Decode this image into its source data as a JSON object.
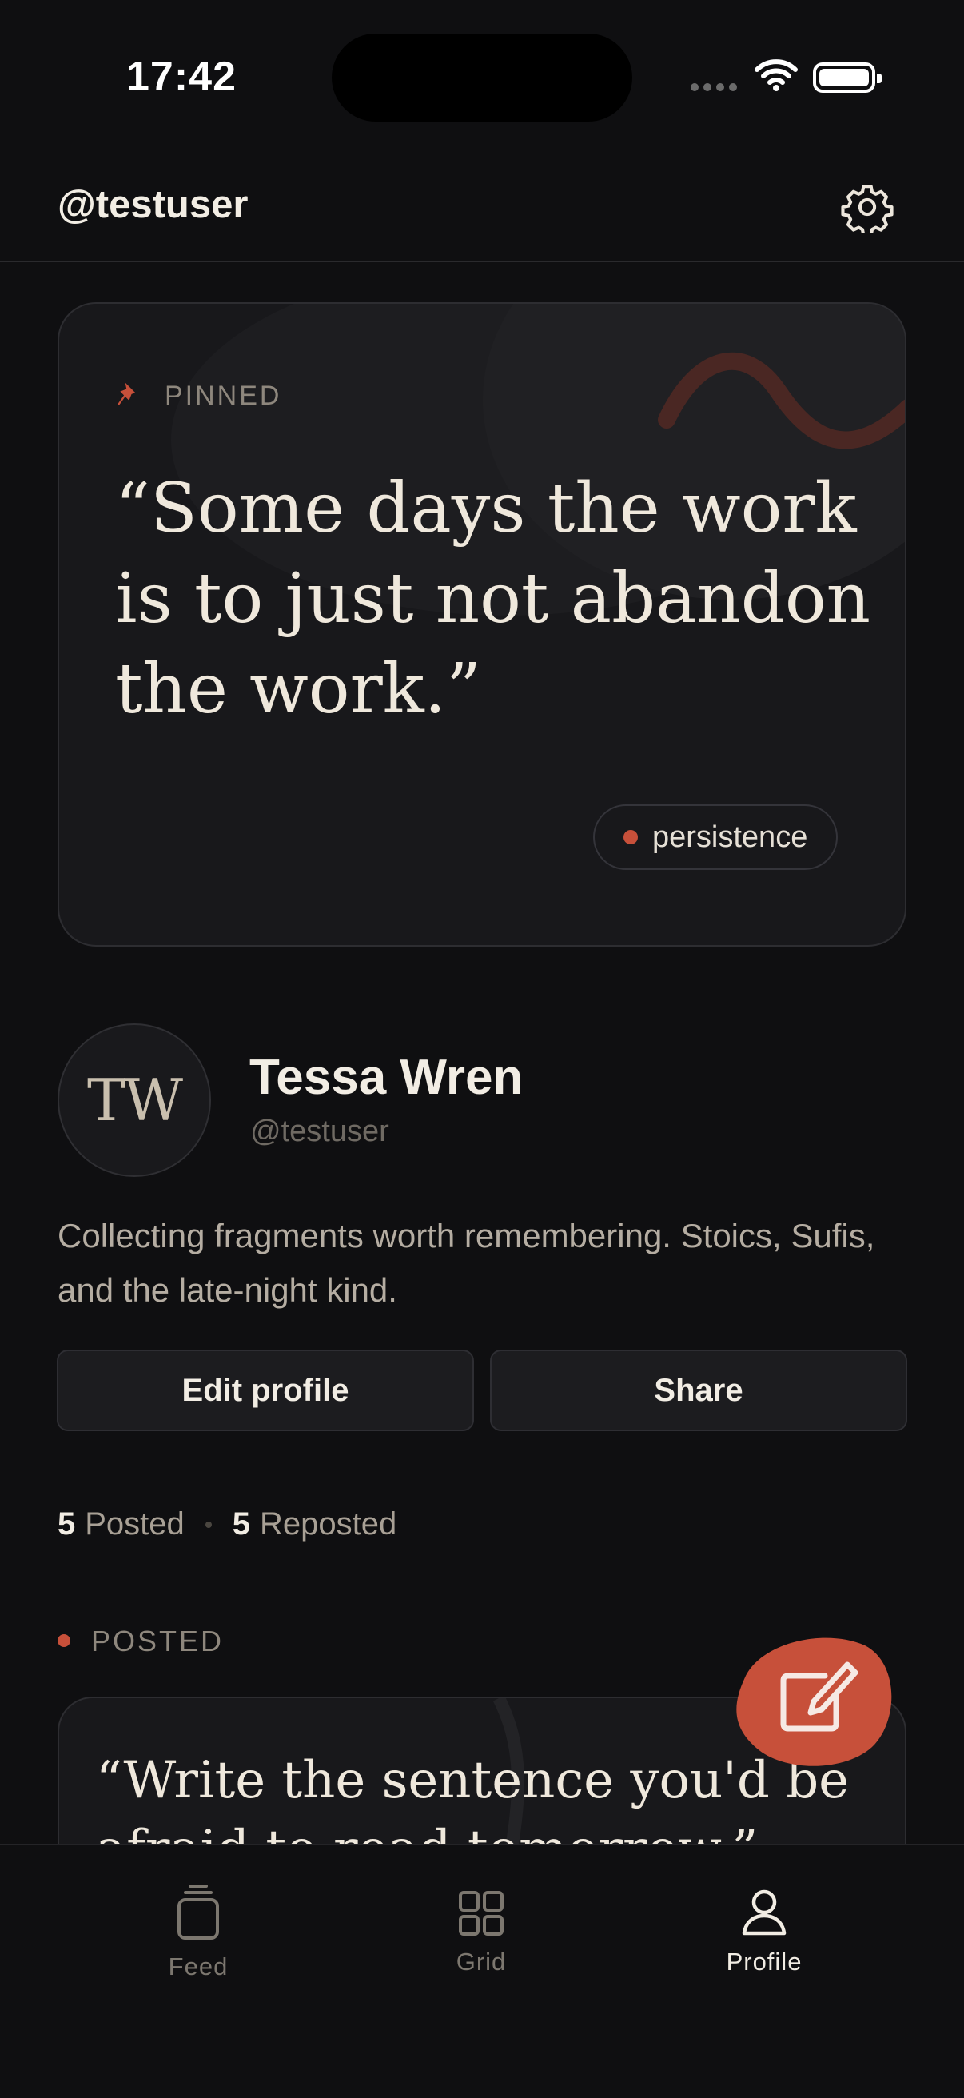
{
  "status_bar": {
    "time": "17:42"
  },
  "header": {
    "handle": "@testuser"
  },
  "pinned": {
    "label": "PINNED",
    "quote": "“Some days the work is to just not abandon the work.”",
    "tag": "persistence"
  },
  "profile": {
    "initials": "TW",
    "name": "Tessa Wren",
    "handle": "@testuser",
    "bio": "Collecting fragments worth remembering. Stoics, Sufis, and the late-night kind.",
    "edit_label": "Edit profile",
    "share_label": "Share"
  },
  "stats": {
    "posted_count": "5",
    "posted_label": "Posted",
    "reposted_count": "5",
    "reposted_label": "Reposted"
  },
  "section": {
    "posted_label": "POSTED"
  },
  "posts": [
    {
      "quote": "“Write the sentence you'd be afraid to read tomorrow.”"
    }
  ],
  "nav": {
    "items": [
      {
        "label": "Feed",
        "icon": "feed-icon"
      },
      {
        "label": "Grid",
        "icon": "grid-icon"
      },
      {
        "label": "Profile",
        "icon": "profile-icon",
        "active": true
      }
    ]
  },
  "colors": {
    "accent": "#c7503a",
    "background": "#0f0f11",
    "card": "#18181b"
  }
}
